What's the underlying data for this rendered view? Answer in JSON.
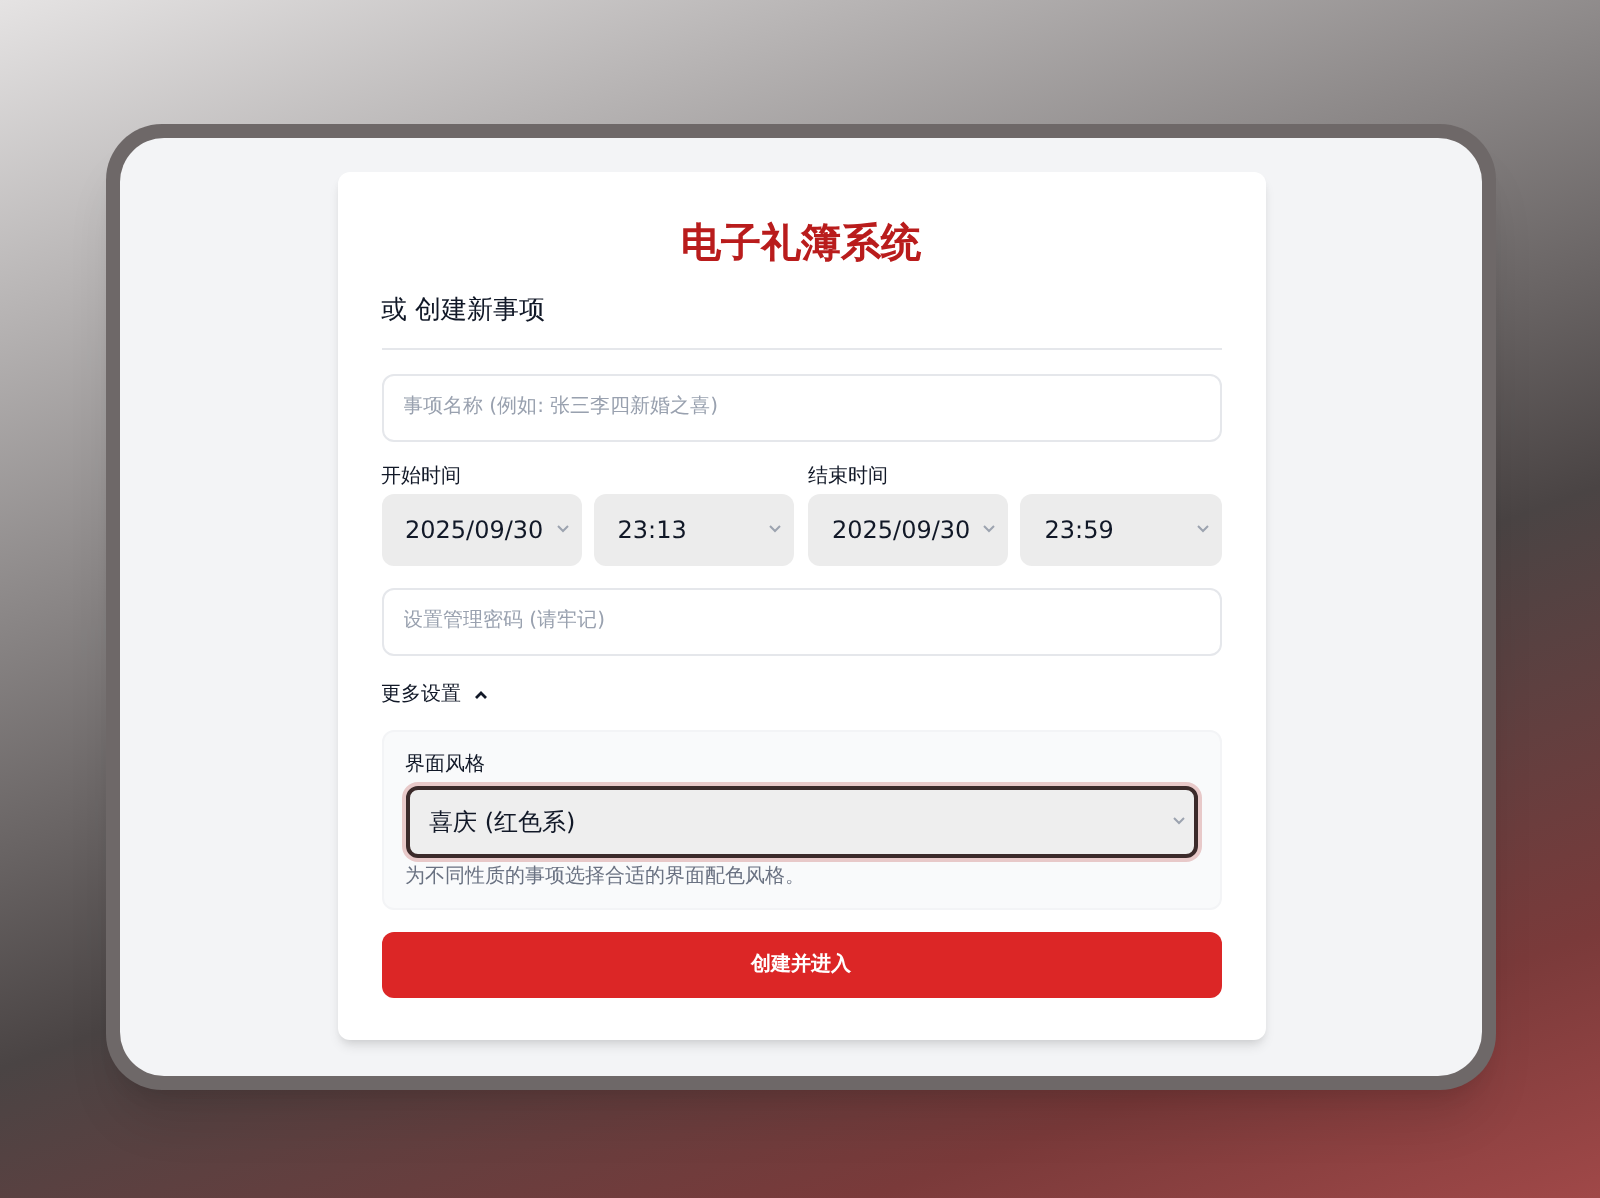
{
  "title": "电子礼簿系统",
  "section_heading": "或 创建新事项",
  "name_field": {
    "placeholder": "事项名称 (例如: 张三李四新婚之喜)"
  },
  "start": {
    "label": "开始时间",
    "date": "2025/09/30",
    "time": "23:13"
  },
  "end": {
    "label": "结束时间",
    "date": "2025/09/30",
    "time": "23:59"
  },
  "password_field": {
    "placeholder": "设置管理密码 (请牢记)"
  },
  "more_settings": {
    "label": "更多设置",
    "expanded": true,
    "theme": {
      "label": "界面风格",
      "value": "喜庆 (红色系)",
      "hint": "为不同性质的事项选择合适的界面配色风格。"
    }
  },
  "submit_button": "创建并进入"
}
